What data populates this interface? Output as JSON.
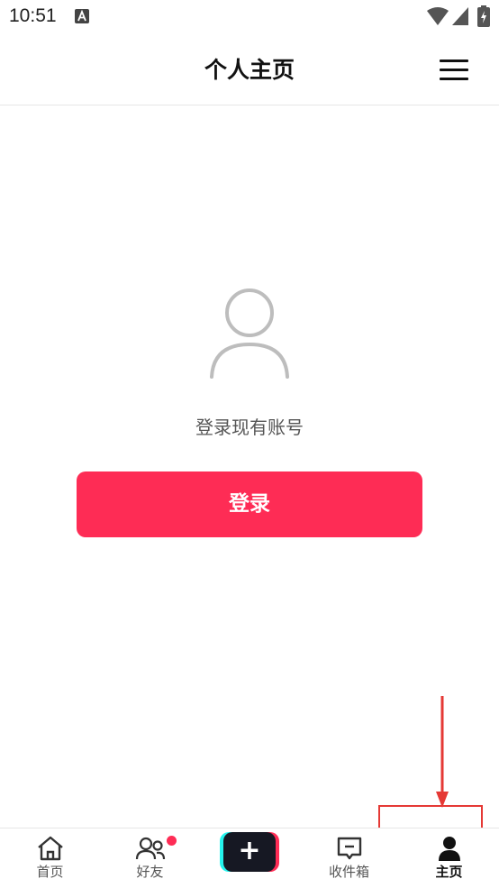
{
  "status_bar": {
    "time": "10:51",
    "icons": [
      "app-a-icon",
      "wifi-icon",
      "signal-icon",
      "battery-charging-icon"
    ]
  },
  "header": {
    "title": "个人主页",
    "menu_icon": "hamburger-menu-icon"
  },
  "main": {
    "avatar_icon": "default-avatar-icon",
    "prompt": "登录现有账号",
    "login_button_label": "登录"
  },
  "bottom_nav": {
    "items": [
      {
        "label": "首页",
        "icon": "home-icon",
        "active": false
      },
      {
        "label": "好友",
        "icon": "friends-icon",
        "active": false,
        "badge": true
      },
      {
        "label": "",
        "icon": "plus-icon",
        "active": false
      },
      {
        "label": "收件箱",
        "icon": "inbox-icon",
        "active": false
      },
      {
        "label": "主页",
        "icon": "profile-icon",
        "active": true
      }
    ]
  },
  "colors": {
    "accent": "#fe2c55",
    "annotation": "#e53935",
    "create_cyan": "#25f4ee",
    "create_dark": "#161823"
  }
}
